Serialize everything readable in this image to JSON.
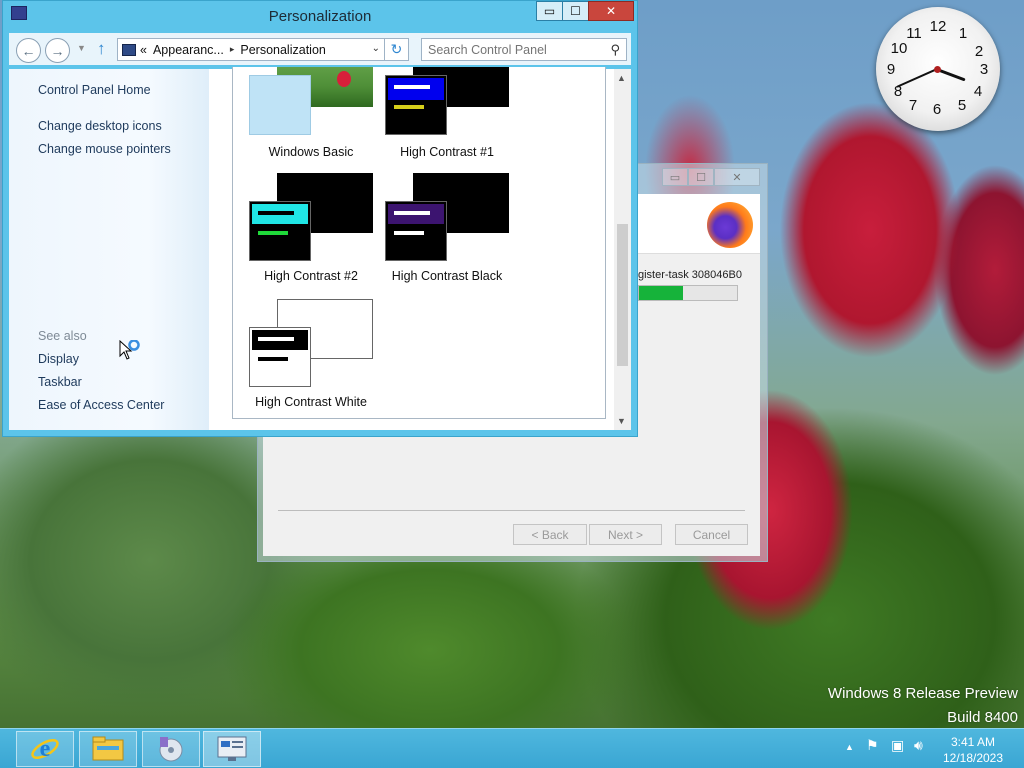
{
  "personalization_window": {
    "title": "Personalization",
    "caption": {
      "minimize": "▭",
      "maximize": "☐",
      "close": "✕"
    },
    "nav": {
      "back_icon": "arrow-left-icon",
      "forward_icon": "arrow-right-icon",
      "up_icon": "arrow-up-icon"
    },
    "address": {
      "overflow": "«",
      "crumb1": "Appearanc...",
      "separator": "▸",
      "crumb2": "Personalization"
    },
    "search": {
      "placeholder": "Search Control Panel"
    },
    "sidebar": {
      "home": "Control Panel Home",
      "links": [
        "Change desktop icons",
        "Change mouse pointers"
      ],
      "see_also_heading": "See also",
      "see_also": [
        "Display",
        "Taskbar",
        "Ease of Access Center"
      ]
    },
    "themes": [
      {
        "name": "Windows Basic"
      },
      {
        "name": "High Contrast #1"
      },
      {
        "name": "High Contrast #2"
      },
      {
        "name": "High Contrast Black"
      },
      {
        "name": "High Contrast White"
      }
    ]
  },
  "installer_dialog": {
    "caption": {
      "minimize": "▭",
      "maximize": "☐",
      "close": "✕"
    },
    "task_text": "gister-task 308046B0",
    "progress_fraction": 0.45,
    "buttons": {
      "back": "< Back",
      "next": "Next >",
      "cancel": "Cancel"
    }
  },
  "clock": {
    "numbers": [
      "12",
      "1",
      "2",
      "3",
      "4",
      "5",
      "6",
      "7",
      "8",
      "9",
      "10",
      "11"
    ],
    "time": "3:41"
  },
  "watermark": {
    "line1": "Windows 8 Release Preview",
    "line2": "Build 8400"
  },
  "taskbar": {
    "pinned": [
      "internet-explorer-icon",
      "file-explorer-icon",
      "media-player-icon",
      "control-panel-icon"
    ],
    "tray_icons": [
      "show-hidden-icons",
      "flag-icon",
      "network-icon",
      "volume-icon"
    ],
    "time": "3:41 AM",
    "date": "12/18/2023"
  },
  "colors": {
    "window_frame": "#5cc4ea",
    "taskbar": "#3aa6d3",
    "progress_fill": "#16b33a",
    "link": "#1e3a5c"
  }
}
